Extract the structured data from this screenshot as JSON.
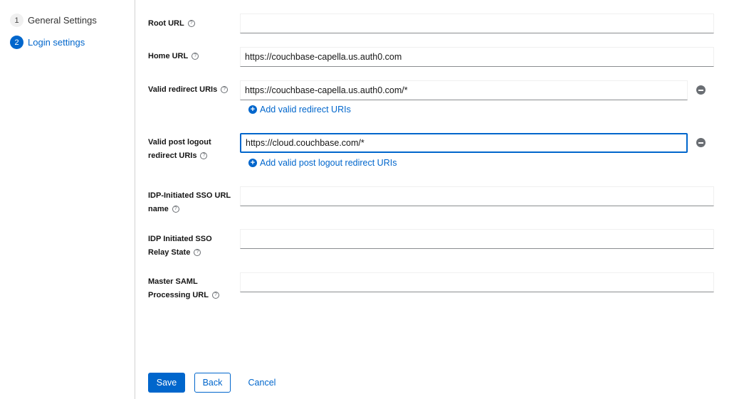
{
  "wizard_steps": [
    {
      "number": "1",
      "label": "General Settings"
    },
    {
      "number": "2",
      "label": "Login settings"
    }
  ],
  "help_glyph": "?",
  "fields": {
    "root_url": {
      "label": "Root URL",
      "value": ""
    },
    "home_url": {
      "label": "Home URL",
      "value": "https://couchbase-capella.us.auth0.com"
    },
    "valid_redirect": {
      "label": "Valid redirect URIs",
      "value": "https://couchbase-capella.us.auth0.com/*",
      "add_label": "Add valid redirect URIs"
    },
    "post_logout": {
      "label_line1": "Valid post logout",
      "label_line2": "redirect URIs",
      "value": "https://cloud.couchbase.com/*",
      "add_label": "Add valid post logout redirect URIs"
    },
    "idp_sso_name": {
      "label_line1": "IDP-Initiated SSO URL",
      "label_line2": "name",
      "value": ""
    },
    "idp_relay": {
      "label_line1": "IDP Initiated SSO",
      "label_line2": "Relay State",
      "value": ""
    },
    "master_saml": {
      "label_line1": "Master SAML",
      "label_line2": "Processing URL",
      "value": ""
    }
  },
  "buttons": {
    "save": "Save",
    "back": "Back",
    "cancel": "Cancel"
  },
  "colors": {
    "primary": "#0066cc",
    "icon_gray": "#6a6e73"
  }
}
